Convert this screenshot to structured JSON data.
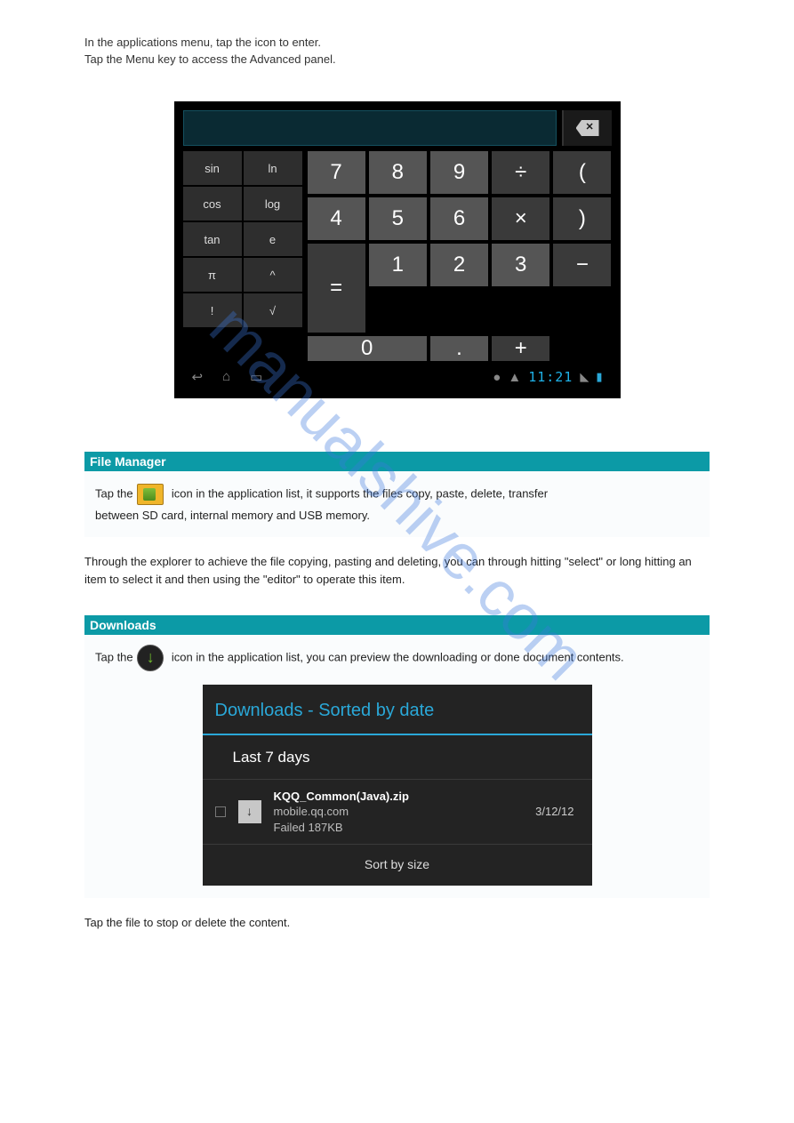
{
  "watermark": "manualshive.com",
  "intro_line1": "In the applications menu, tap the icon",
  "intro_line1_after": " to enter.",
  "intro_line2": "Tap the Menu key to access the Advanced panel.",
  "calculator": {
    "func": [
      "sin",
      "ln",
      "cos",
      "log",
      "tan",
      "e",
      "π",
      "^",
      "!",
      "√"
    ],
    "row1": [
      "7",
      "8",
      "9",
      "÷",
      "("
    ],
    "row2": [
      "4",
      "5",
      "6",
      "×",
      ")"
    ],
    "row3": [
      "1",
      "2",
      "3",
      "−"
    ],
    "row4_zero": "0",
    "row4_dot": ".",
    "row4_plus": "+",
    "equals": "=",
    "clock": "11:21"
  },
  "file_mgr": {
    "heading": "File Manager",
    "body_before_icon": "Tap the ",
    "body_after_icon": " icon in the application list, it supports the files copy, paste, delete, transfer",
    "body_line2": "between SD card, internal memory and USB memory."
  },
  "explorer_para": "Through the explorer to achieve the file copying, pasting and deleting, you can through hitting  \"select\" or long hitting an item to select it and then using the \"editor\" to operate this item.",
  "downloads": {
    "heading": "Downloads",
    "body_before_icon": "Tap the ",
    "body_after_icon": " icon in the application list, you can preview the downloading or done document contents.",
    "panel_title": "Downloads - Sorted by date",
    "group": "Last 7 days",
    "item": {
      "name": "KQQ_Common(Java).zip",
      "source": "mobile.qq.com",
      "status": "Failed   187KB",
      "date": "3/12/12"
    },
    "sort": "Sort by size"
  },
  "trailer": "Tap the file to stop or delete the content."
}
